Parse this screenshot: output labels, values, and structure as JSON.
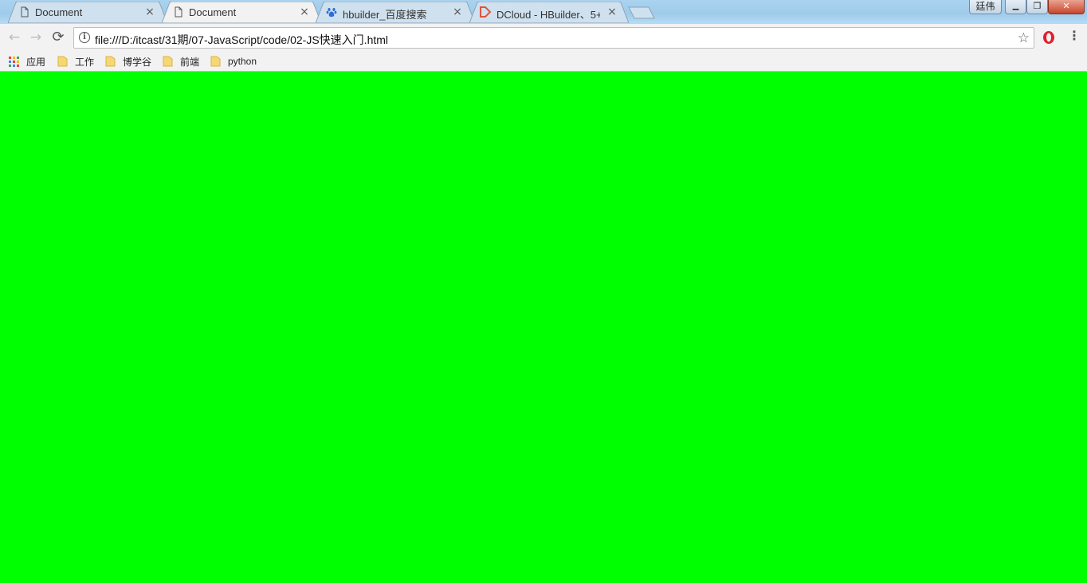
{
  "tabs": [
    {
      "title": "Document",
      "icon": "document-icon",
      "close": "×"
    },
    {
      "title": "Document",
      "icon": "document-icon",
      "close": "×"
    },
    {
      "title": "hbuilder_百度搜索",
      "icon": "baidu-paw-icon",
      "close": "×"
    },
    {
      "title": "DCloud - HBuilder、5+",
      "icon": "dcloud-logo-icon",
      "close": "×"
    }
  ],
  "window": {
    "profile_label": "廷伟",
    "minimize": "▁",
    "maximize": "❐",
    "close": "✕"
  },
  "toolbar": {
    "back": "←",
    "forward": "→",
    "reload": "⟳",
    "info": "i",
    "url": "file:///D:/itcast/31期/07-JavaScript/code/02-JS快速入门.html",
    "star": "☆",
    "menu": "⋮"
  },
  "bookmarks": {
    "apps_label": "应用",
    "items": [
      {
        "label": "工作",
        "icon": "folder-icon"
      },
      {
        "label": "博学谷",
        "icon": "folder-icon"
      },
      {
        "label": "前端",
        "icon": "folder-icon"
      },
      {
        "label": "python",
        "icon": "folder-icon"
      }
    ]
  },
  "colors": {
    "page_background": "#00ff00",
    "active_tab": "#f2f2f2",
    "inactive_tab": "#cfe1ee",
    "folder": "#f7d774"
  }
}
